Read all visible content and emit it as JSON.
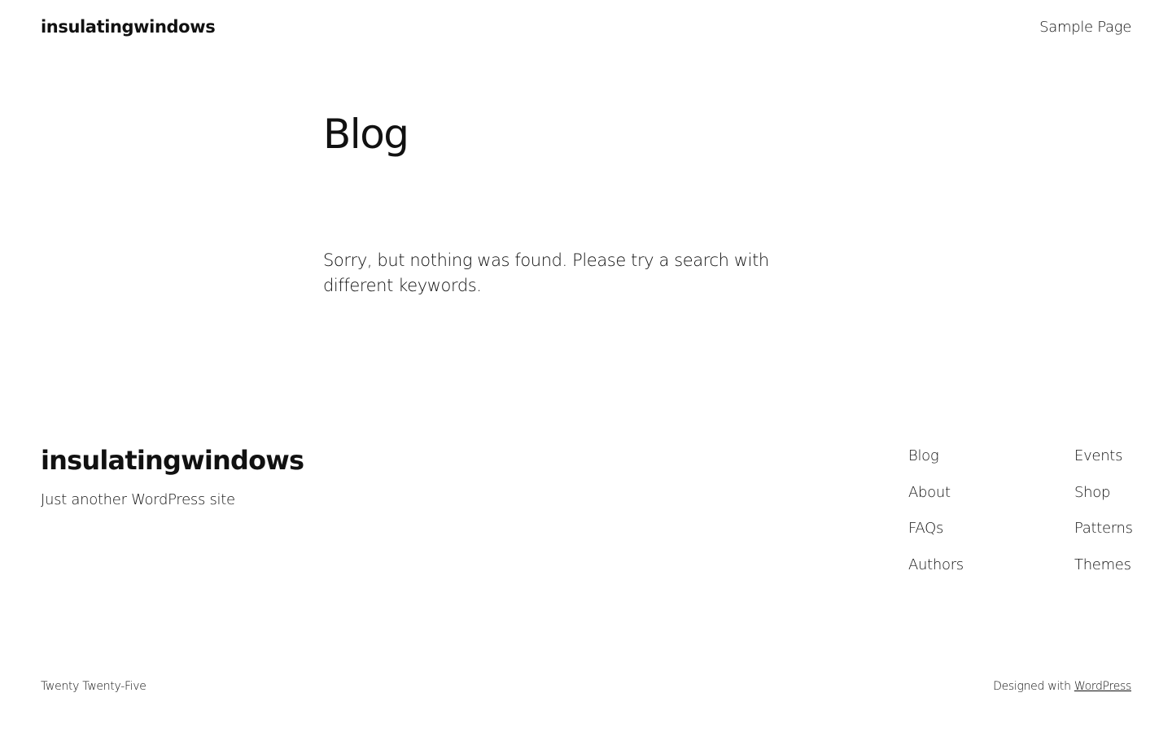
{
  "header": {
    "site_title": "insulatingwindows",
    "nav": [
      "Sample Page"
    ]
  },
  "main": {
    "title": "Blog",
    "message": "Sorry, but nothing was found. Please try a search with different keywords."
  },
  "footer": {
    "site_title": "insulatingwindows",
    "tagline": "Just another WordPress site",
    "nav_col1": [
      "Blog",
      "About",
      "FAQs",
      "Authors"
    ],
    "nav_col2": [
      "Events",
      "Shop",
      "Patterns",
      "Themes"
    ],
    "theme_credit": "Twenty Twenty-Five",
    "designed_with": "Designed with",
    "wordpress_link": "WordPress"
  },
  "colors": {
    "background": "#ffffff",
    "text": "#111111"
  }
}
